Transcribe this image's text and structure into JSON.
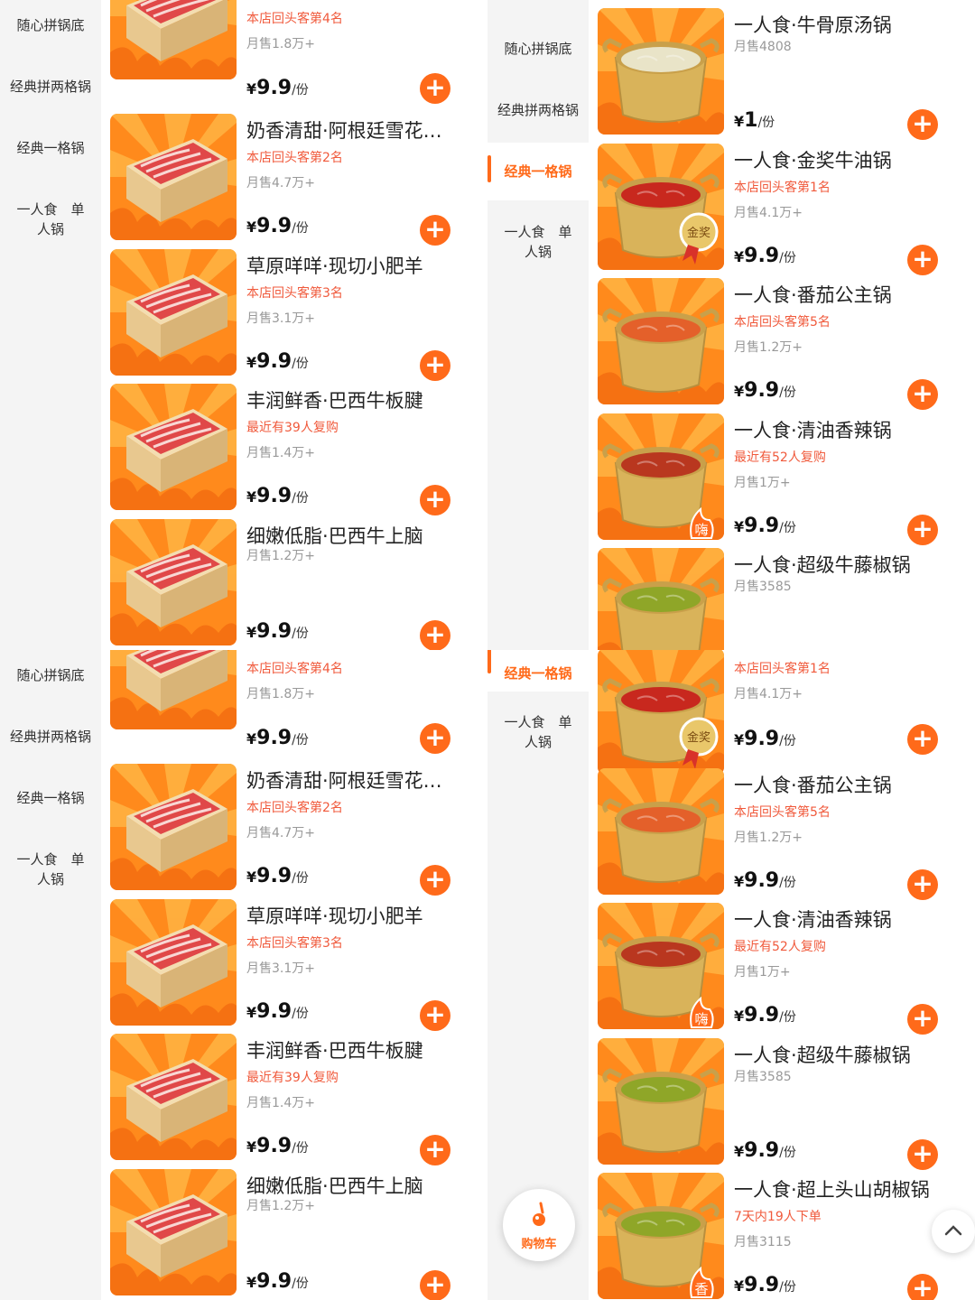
{
  "sidebar": {
    "mix_pot": "随心拼锅底",
    "double_pot": "经典拼两格锅",
    "single_pot": "经典一格锅",
    "solo_line1": "一人食　单",
    "solo_line2": "人锅"
  },
  "meat_items": [
    {
      "name": "",
      "tag": "本店回头客第4名",
      "sales": "月售1.8万+",
      "price": "9.9"
    },
    {
      "name": "奶香清甜·阿根廷雪花…",
      "tag": "本店回头客第2名",
      "sales": "月售4.7万+",
      "price": "9.9"
    },
    {
      "name": "草原咩咩·现切小肥羊",
      "tag": "本店回头客第3名",
      "sales": "月售3.1万+",
      "price": "9.9"
    },
    {
      "name": "丰润鲜香·巴西牛板腱",
      "tag": "最近有39人复购",
      "sales": "月售1.4万+",
      "price": "9.9"
    },
    {
      "name": "细嫩低脂·巴西牛上脑",
      "tag": "",
      "sales": "月售1.2万+",
      "price": "9.9"
    }
  ],
  "pot_items_top": [
    {
      "name": "一人食·牛骨原汤锅",
      "tag": "",
      "sales": "月售4808",
      "price": "1",
      "badge": ""
    },
    {
      "name": "一人食·金奖牛油锅",
      "tag": "本店回头客第1名",
      "sales": "月售4.1万+",
      "price": "9.9",
      "badge": "金奖"
    },
    {
      "name": "一人食·番茄公主锅",
      "tag": "本店回头客第5名",
      "sales": "月售1.2万+",
      "price": "9.9",
      "badge": ""
    },
    {
      "name": "一人食·清油香辣锅",
      "tag": "最近有52人复购",
      "sales": "月售1万+",
      "price": "9.9",
      "badge": "嗨"
    },
    {
      "name": "一人食·超级牛藤椒锅",
      "tag": "",
      "sales": "月售3585",
      "price": "",
      "badge": ""
    }
  ],
  "pot_items_bottom": [
    {
      "name": "",
      "tag": "本店回头客第1名",
      "sales": "月售4.1万+",
      "price": "9.9",
      "badge": "金奖"
    },
    {
      "name": "一人食·番茄公主锅",
      "tag": "本店回头客第5名",
      "sales": "月售1.2万+",
      "price": "9.9",
      "badge": ""
    },
    {
      "name": "一人食·清油香辣锅",
      "tag": "最近有52人复购",
      "sales": "月售1万+",
      "price": "9.9",
      "badge": "嗨"
    },
    {
      "name": "一人食·超级牛藤椒锅",
      "tag": "",
      "sales": "月售3585",
      "price": "9.9",
      "badge": ""
    },
    {
      "name": "一人食·超上头山胡椒锅",
      "tag": "7天内19人下单",
      "sales": "月售3115",
      "price": "9.9",
      "badge": "香"
    }
  ],
  "currency": "¥",
  "unit": "/份",
  "cart": {
    "label": "购物车"
  },
  "colors": {
    "accent": "#ff6a1a",
    "tag": "#f05a3c",
    "sidebar_bg": "#f4f4f4"
  }
}
